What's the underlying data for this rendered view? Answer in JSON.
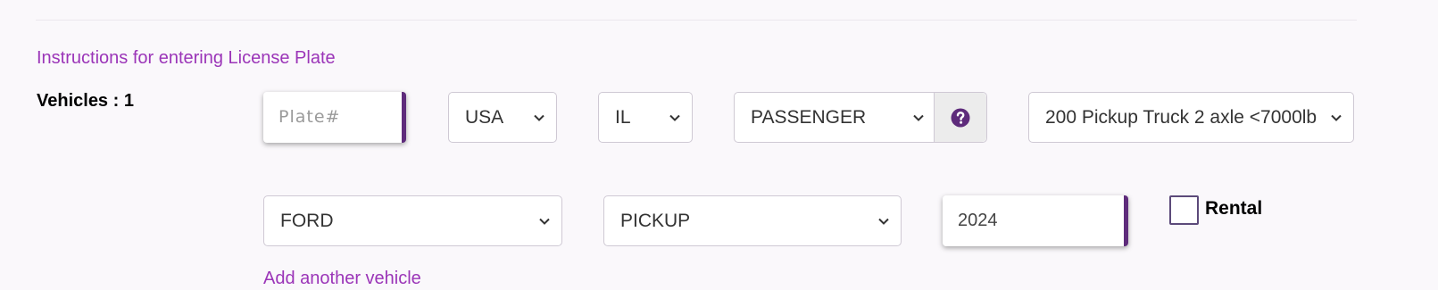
{
  "links": {
    "instructions": "Instructions for entering License Plate",
    "add_vehicle": "Add another vehicle"
  },
  "vehicles": {
    "label": "Vehicles : 1"
  },
  "plate": {
    "placeholder": "Plate#",
    "value": ""
  },
  "country": {
    "selected": "USA"
  },
  "state": {
    "selected": "IL"
  },
  "plate_type": {
    "selected": "PASSENGER"
  },
  "vehicle_class": {
    "selected": "200 Pickup Truck 2 axle <7000lb"
  },
  "make": {
    "selected": "FORD"
  },
  "model": {
    "selected": "PICKUP"
  },
  "year": {
    "value": "2024"
  },
  "rental": {
    "label": "Rental",
    "checked": false
  },
  "icons": {
    "help": "question-circle-icon",
    "dropdown": "chevron-down-icon"
  },
  "colors": {
    "accent": "#5e2b7b",
    "link": "#9b35b8",
    "background": "#faf8fb"
  }
}
